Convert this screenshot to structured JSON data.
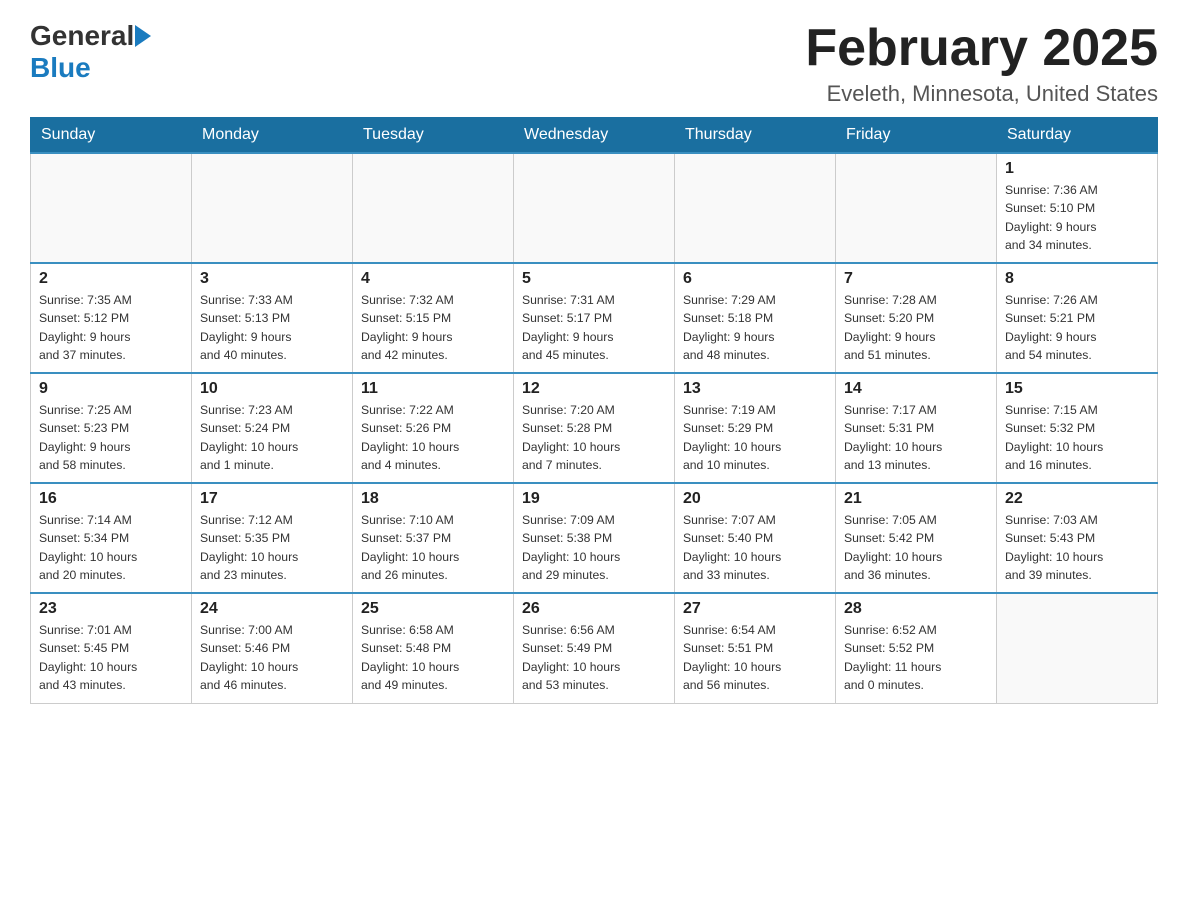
{
  "header": {
    "logo_general": "General",
    "logo_blue": "Blue",
    "title": "February 2025",
    "subtitle": "Eveleth, Minnesota, United States"
  },
  "weekdays": [
    "Sunday",
    "Monday",
    "Tuesday",
    "Wednesday",
    "Thursday",
    "Friday",
    "Saturday"
  ],
  "weeks": [
    [
      {
        "day": "",
        "info": ""
      },
      {
        "day": "",
        "info": ""
      },
      {
        "day": "",
        "info": ""
      },
      {
        "day": "",
        "info": ""
      },
      {
        "day": "",
        "info": ""
      },
      {
        "day": "",
        "info": ""
      },
      {
        "day": "1",
        "info": "Sunrise: 7:36 AM\nSunset: 5:10 PM\nDaylight: 9 hours\nand 34 minutes."
      }
    ],
    [
      {
        "day": "2",
        "info": "Sunrise: 7:35 AM\nSunset: 5:12 PM\nDaylight: 9 hours\nand 37 minutes."
      },
      {
        "day": "3",
        "info": "Sunrise: 7:33 AM\nSunset: 5:13 PM\nDaylight: 9 hours\nand 40 minutes."
      },
      {
        "day": "4",
        "info": "Sunrise: 7:32 AM\nSunset: 5:15 PM\nDaylight: 9 hours\nand 42 minutes."
      },
      {
        "day": "5",
        "info": "Sunrise: 7:31 AM\nSunset: 5:17 PM\nDaylight: 9 hours\nand 45 minutes."
      },
      {
        "day": "6",
        "info": "Sunrise: 7:29 AM\nSunset: 5:18 PM\nDaylight: 9 hours\nand 48 minutes."
      },
      {
        "day": "7",
        "info": "Sunrise: 7:28 AM\nSunset: 5:20 PM\nDaylight: 9 hours\nand 51 minutes."
      },
      {
        "day": "8",
        "info": "Sunrise: 7:26 AM\nSunset: 5:21 PM\nDaylight: 9 hours\nand 54 minutes."
      }
    ],
    [
      {
        "day": "9",
        "info": "Sunrise: 7:25 AM\nSunset: 5:23 PM\nDaylight: 9 hours\nand 58 minutes."
      },
      {
        "day": "10",
        "info": "Sunrise: 7:23 AM\nSunset: 5:24 PM\nDaylight: 10 hours\nand 1 minute."
      },
      {
        "day": "11",
        "info": "Sunrise: 7:22 AM\nSunset: 5:26 PM\nDaylight: 10 hours\nand 4 minutes."
      },
      {
        "day": "12",
        "info": "Sunrise: 7:20 AM\nSunset: 5:28 PM\nDaylight: 10 hours\nand 7 minutes."
      },
      {
        "day": "13",
        "info": "Sunrise: 7:19 AM\nSunset: 5:29 PM\nDaylight: 10 hours\nand 10 minutes."
      },
      {
        "day": "14",
        "info": "Sunrise: 7:17 AM\nSunset: 5:31 PM\nDaylight: 10 hours\nand 13 minutes."
      },
      {
        "day": "15",
        "info": "Sunrise: 7:15 AM\nSunset: 5:32 PM\nDaylight: 10 hours\nand 16 minutes."
      }
    ],
    [
      {
        "day": "16",
        "info": "Sunrise: 7:14 AM\nSunset: 5:34 PM\nDaylight: 10 hours\nand 20 minutes."
      },
      {
        "day": "17",
        "info": "Sunrise: 7:12 AM\nSunset: 5:35 PM\nDaylight: 10 hours\nand 23 minutes."
      },
      {
        "day": "18",
        "info": "Sunrise: 7:10 AM\nSunset: 5:37 PM\nDaylight: 10 hours\nand 26 minutes."
      },
      {
        "day": "19",
        "info": "Sunrise: 7:09 AM\nSunset: 5:38 PM\nDaylight: 10 hours\nand 29 minutes."
      },
      {
        "day": "20",
        "info": "Sunrise: 7:07 AM\nSunset: 5:40 PM\nDaylight: 10 hours\nand 33 minutes."
      },
      {
        "day": "21",
        "info": "Sunrise: 7:05 AM\nSunset: 5:42 PM\nDaylight: 10 hours\nand 36 minutes."
      },
      {
        "day": "22",
        "info": "Sunrise: 7:03 AM\nSunset: 5:43 PM\nDaylight: 10 hours\nand 39 minutes."
      }
    ],
    [
      {
        "day": "23",
        "info": "Sunrise: 7:01 AM\nSunset: 5:45 PM\nDaylight: 10 hours\nand 43 minutes."
      },
      {
        "day": "24",
        "info": "Sunrise: 7:00 AM\nSunset: 5:46 PM\nDaylight: 10 hours\nand 46 minutes."
      },
      {
        "day": "25",
        "info": "Sunrise: 6:58 AM\nSunset: 5:48 PM\nDaylight: 10 hours\nand 49 minutes."
      },
      {
        "day": "26",
        "info": "Sunrise: 6:56 AM\nSunset: 5:49 PM\nDaylight: 10 hours\nand 53 minutes."
      },
      {
        "day": "27",
        "info": "Sunrise: 6:54 AM\nSunset: 5:51 PM\nDaylight: 10 hours\nand 56 minutes."
      },
      {
        "day": "28",
        "info": "Sunrise: 6:52 AM\nSunset: 5:52 PM\nDaylight: 11 hours\nand 0 minutes."
      },
      {
        "day": "",
        "info": ""
      }
    ]
  ]
}
